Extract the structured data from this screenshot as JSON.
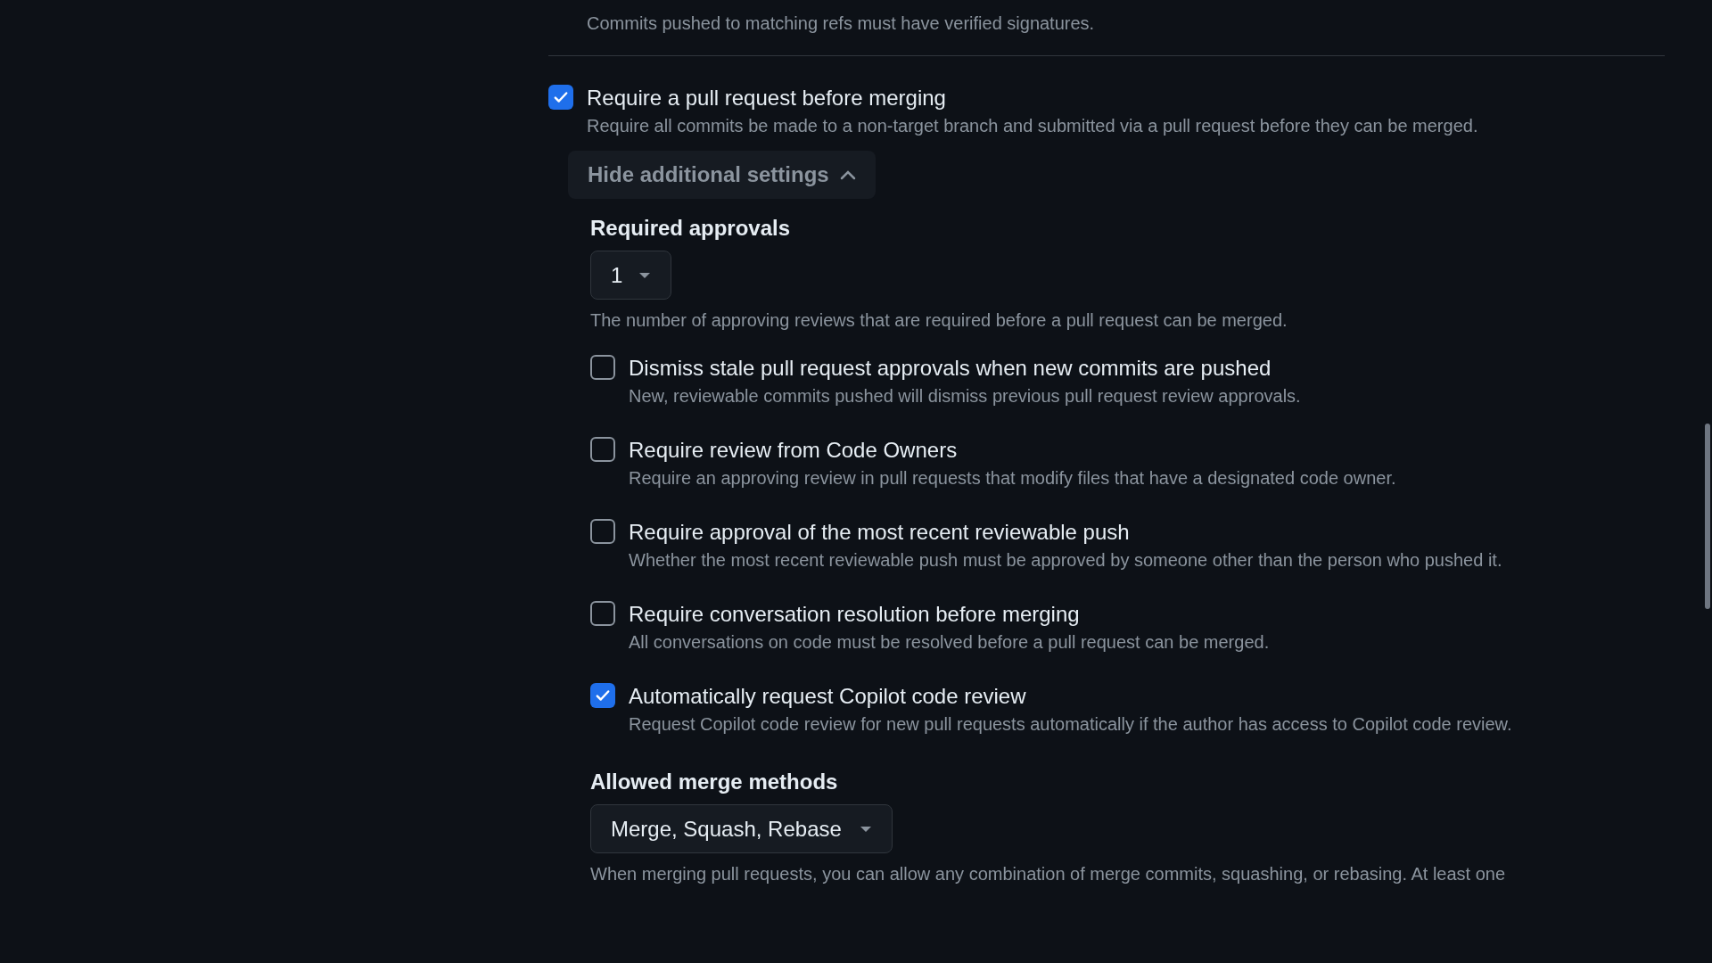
{
  "top_rule_description": "Commits pushed to matching refs must have verified signatures.",
  "pull_request_rule": {
    "label": "Require a pull request before merging",
    "description": "Require all commits be made to a non-target branch and submitted via a pull request before they can be merged.",
    "checked": true
  },
  "toggle_button": {
    "label": "Hide additional settings",
    "expanded": true
  },
  "required_approvals": {
    "heading": "Required approvals",
    "value": "1",
    "description": "The number of approving reviews that are required before a pull request can be merged."
  },
  "options": [
    {
      "label": "Dismiss stale pull request approvals when new commits are pushed",
      "description": "New, reviewable commits pushed will dismiss previous pull request review approvals.",
      "checked": false
    },
    {
      "label": "Require review from Code Owners",
      "description": "Require an approving review in pull requests that modify files that have a designated code owner.",
      "checked": false
    },
    {
      "label": "Require approval of the most recent reviewable push",
      "description": "Whether the most recent reviewable push must be approved by someone other than the person who pushed it.",
      "checked": false
    },
    {
      "label": "Require conversation resolution before merging",
      "description": "All conversations on code must be resolved before a pull request can be merged.",
      "checked": false
    },
    {
      "label": "Automatically request Copilot code review",
      "description": "Request Copilot code review for new pull requests automatically if the author has access to Copilot code review.",
      "checked": true
    }
  ],
  "merge_methods": {
    "heading": "Allowed merge methods",
    "value": "Merge, Squash, Rebase",
    "description": "When merging pull requests, you can allow any combination of merge commits, squashing, or rebasing. At least one"
  }
}
